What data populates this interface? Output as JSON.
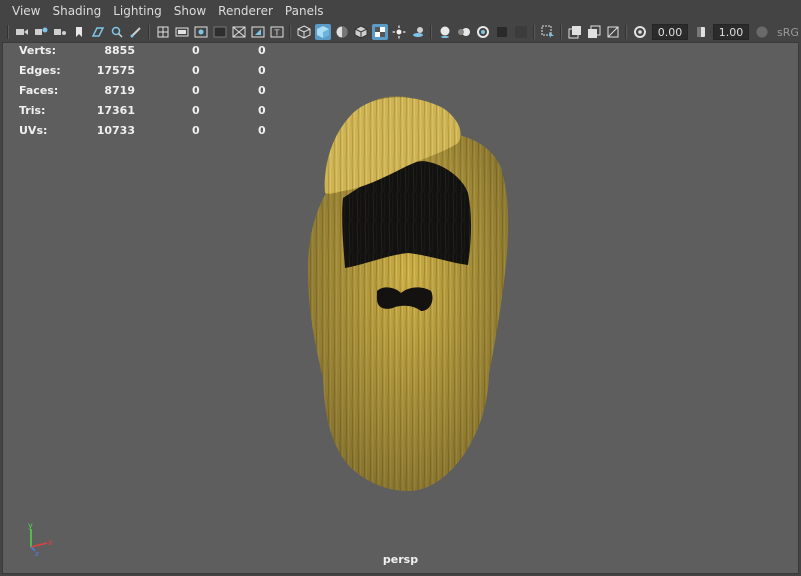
{
  "menubar": {
    "items": [
      "View",
      "Shading",
      "Lighting",
      "Show",
      "Renderer",
      "Panels"
    ]
  },
  "toolbar": {
    "field_a": "0.00",
    "field_b": "1.00",
    "color_space": "sRG"
  },
  "hud": {
    "rows": [
      {
        "label": "Verts:",
        "v1": "8855",
        "v2": "0",
        "v3": "0"
      },
      {
        "label": "Edges:",
        "v1": "17575",
        "v2": "0",
        "v3": "0"
      },
      {
        "label": "Faces:",
        "v1": "8719",
        "v2": "0",
        "v3": "0"
      },
      {
        "label": "Tris:",
        "v1": "17361",
        "v2": "0",
        "v3": "0"
      },
      {
        "label": "UVs:",
        "v1": "10733",
        "v2": "0",
        "v3": "0"
      }
    ]
  },
  "viewport": {
    "camera": "persp",
    "model_color": "#c9ad45",
    "background_color": "#5e5e5e"
  },
  "axis_labels": {
    "x": "x",
    "y": "y",
    "z": "z"
  }
}
